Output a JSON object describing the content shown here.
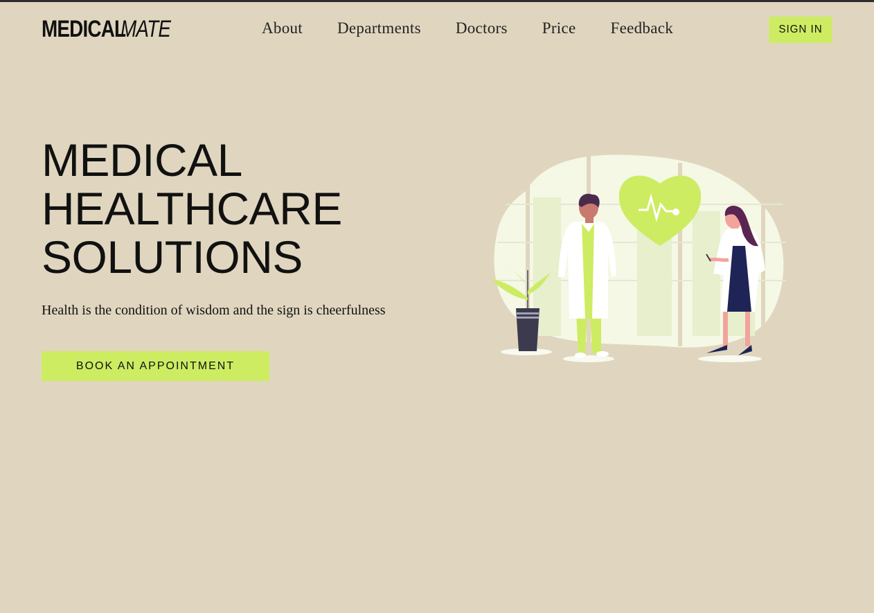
{
  "colors": {
    "background": "#e0d6bf",
    "accent": "#cdec62",
    "text": "#111111"
  },
  "logo": {
    "bold": "MEDICAL",
    "thin": "MATE"
  },
  "nav": {
    "items": [
      "About",
      "Departments",
      "Doctors",
      "Price",
      "Feedback"
    ]
  },
  "header": {
    "signin_label": "SIGN IN"
  },
  "hero": {
    "title_lines": [
      "MEDICAL",
      "HEALTHCARE",
      "SOLUTIONS"
    ],
    "tagline": "Health is the condition of wisdom and the sign is cheerfulness",
    "cta_label": "BOOK AN APPOINTMENT"
  },
  "illustration": {
    "icons": [
      "heart-pulse-icon",
      "doctor-figure",
      "nurse-figure",
      "plant-pot"
    ]
  }
}
